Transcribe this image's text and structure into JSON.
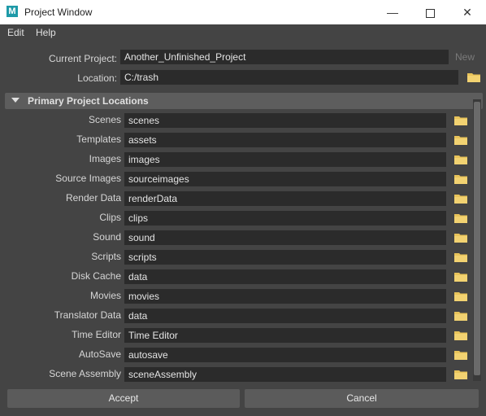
{
  "window": {
    "title": "Project Window",
    "app_icon_letter": "M"
  },
  "menu": {
    "items": [
      "Edit",
      "Help"
    ]
  },
  "current_project": {
    "label": "Current Project:",
    "value": "Another_Unfinished_Project",
    "new_label": "New"
  },
  "location": {
    "label": "Location:",
    "value": "C:/trash"
  },
  "section": {
    "title": "Primary Project Locations"
  },
  "locations": [
    {
      "label": "Scenes",
      "value": "scenes"
    },
    {
      "label": "Templates",
      "value": "assets"
    },
    {
      "label": "Images",
      "value": "images"
    },
    {
      "label": "Source Images",
      "value": "sourceimages"
    },
    {
      "label": "Render Data",
      "value": "renderData"
    },
    {
      "label": "Clips",
      "value": "clips"
    },
    {
      "label": "Sound",
      "value": "sound"
    },
    {
      "label": "Scripts",
      "value": "scripts"
    },
    {
      "label": "Disk Cache",
      "value": "data"
    },
    {
      "label": "Movies",
      "value": "movies"
    },
    {
      "label": "Translator Data",
      "value": "data"
    },
    {
      "label": "Time Editor",
      "value": "Time Editor"
    },
    {
      "label": "AutoSave",
      "value": "autosave"
    },
    {
      "label": "Scene Assembly",
      "value": "sceneAssembly"
    }
  ],
  "buttons": {
    "accept": "Accept",
    "cancel": "Cancel"
  },
  "colors": {
    "folder": "#e8c35a",
    "field_bg": "#2b2b2b",
    "panel_bg": "#444444"
  },
  "icons": {
    "folder": "folder-icon",
    "minimize": "minimize-icon",
    "maximize": "maximize-icon",
    "close": "close-icon"
  }
}
